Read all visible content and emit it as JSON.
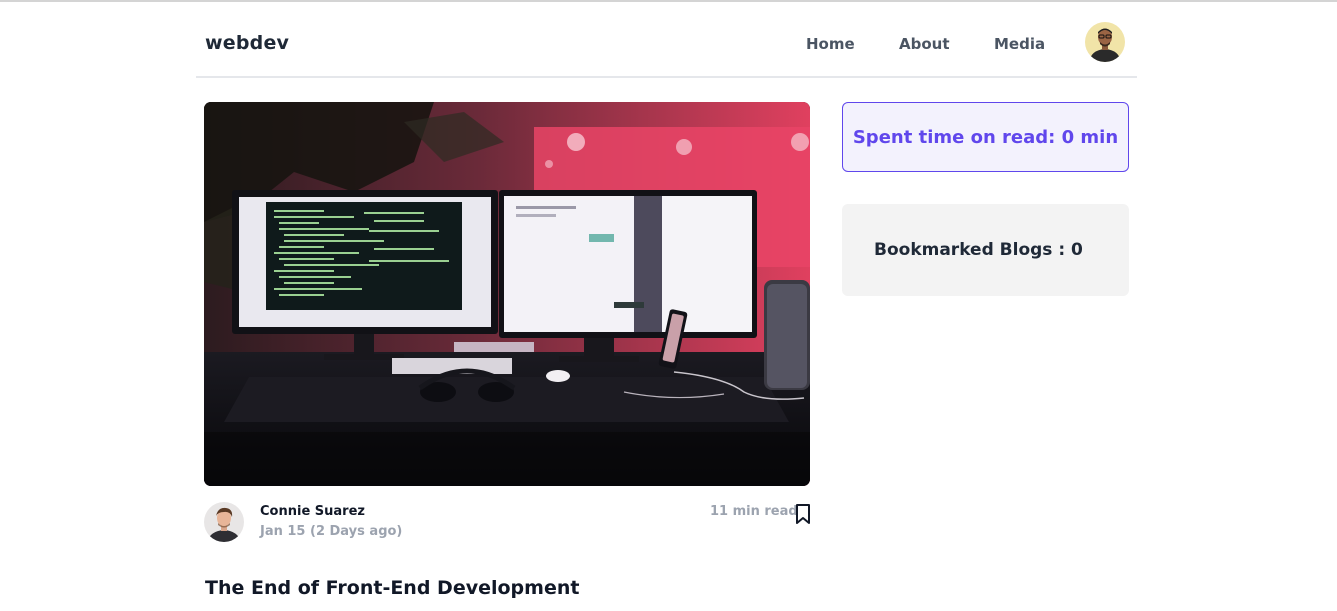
{
  "header": {
    "brand": "webdev",
    "nav": [
      {
        "label": "Home"
      },
      {
        "label": "About"
      },
      {
        "label": "Media"
      }
    ],
    "avatar_icon": "user-avatar-icon"
  },
  "post": {
    "image_icon": "hero-desk-computer-image",
    "author": "Connie Suarez",
    "date": "Jan 15 (2 Days ago)",
    "read_time": "11 min read",
    "bookmark_icon": "bookmark-icon",
    "title": "The End of Front-End Development"
  },
  "sidebar": {
    "spent_time": "Spent time on read: 0 min",
    "bookmarked": "Bookmarked Blogs : 0"
  },
  "colors": {
    "accent": "#6047ec",
    "sidebar_bg": "#f3f3f3",
    "text_dark": "#111827",
    "text_muted": "#9ca3af"
  }
}
